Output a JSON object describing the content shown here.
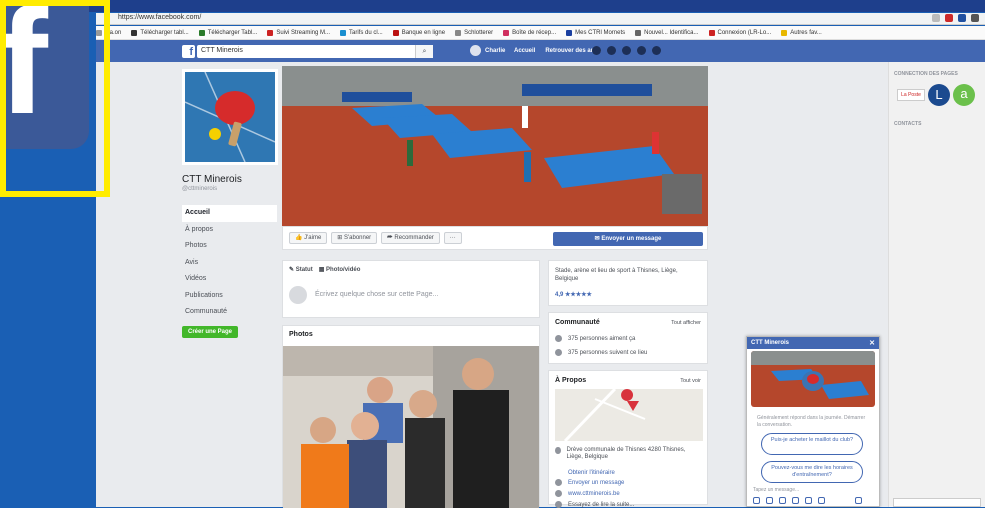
{
  "browser": {
    "url": "https://www.facebook.com/",
    "bookmarks": [
      "Ga.on",
      "Télécharger tabl...",
      "Télécharger Tabl...",
      "Suivi Streaming M...",
      "Tarifs du cl...",
      "Banque en ligne",
      "Schlotterer",
      "Boîte de récep...",
      "Mes CTRl Mornets",
      "Nouvel... Identifica...",
      "Connexion (LR-Lo...",
      "Autres fav..."
    ]
  },
  "fb_nav": {
    "logo": "f",
    "search_value": "CTT Minerois",
    "search_icon": "search-icon",
    "user_name": "Charlie",
    "links": [
      "Accueil",
      "Retrouver des amis"
    ]
  },
  "page": {
    "name": "CTT Minerois",
    "handle": "@cttminerois",
    "nav": [
      "Accueil",
      "À propos",
      "Photos",
      "Avis",
      "Vidéos",
      "Publications",
      "Communauté"
    ],
    "create_button": "Créer une Page"
  },
  "actions": {
    "like": "👍 J'aime",
    "follow": "⊞ S'abonner",
    "share": "⮫ Recommander",
    "more": "···",
    "send_message": "✉ Envoyer un message"
  },
  "composer": {
    "tabs": [
      "✎ Statut",
      "▦ Photo/vidéo"
    ],
    "placeholder": "Écrivez quelque chose sur cette Page..."
  },
  "photos": {
    "title": "Photos"
  },
  "about": {
    "description": "Stade, arène et lieu de sport à Thisnes, Liège, Belgique",
    "rating": "4,9 ★★★★★"
  },
  "community": {
    "title": "Communauté",
    "link": "Tout afficher",
    "rows": [
      "375 personnes aiment ça",
      "375 personnes suivent ce lieu"
    ]
  },
  "apropos": {
    "title": "À Propos",
    "link": "Tout voir",
    "address": "Drève communale de Thisnes 4280 Thisnes, Liège, Belgique",
    "itinerary": "Obtenir l'itinéraire",
    "message": "Envoyer un message",
    "website": "www.cttminerois.be",
    "more": "Essayez de lire la suite..."
  },
  "right_sidebar": {
    "title": "CONNECTION DES PAGES",
    "contacts": "CONTACTS",
    "logos": [
      "La Poste",
      "L",
      "a"
    ]
  },
  "chat": {
    "title": "CTT Minerois",
    "info": "Généralement répond dans la journée. Démarrer la conversation.",
    "quick_replies": [
      "Puis-je acheter le maillot du club?",
      "Pouvez-vous me dire les horaires d'entraînement?"
    ],
    "input_placeholder": "Tapez un message..."
  },
  "overlay": {
    "logo_letter": "f"
  },
  "colors": {
    "fb_blue": "#4267b2",
    "page_bg": "#e9ebee",
    "highlight": "#ffec00",
    "green": "#42b72a"
  }
}
